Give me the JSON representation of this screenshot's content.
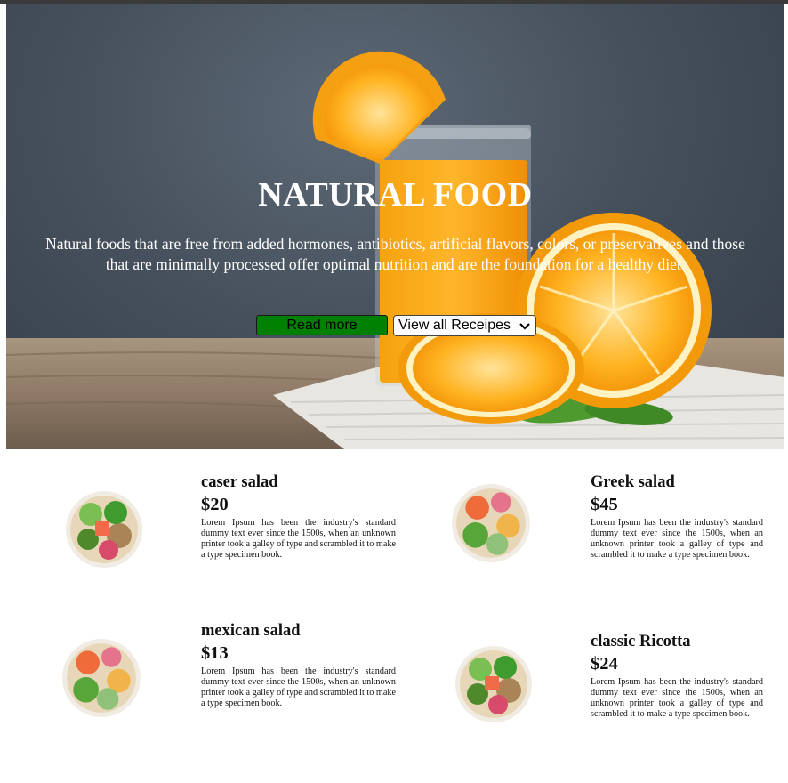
{
  "hero": {
    "title": "NATURAL FOOD",
    "description": "Natural foods that are free from added hormones, antibiotics, artificial flavors, colors, or preservatives and those that are minimally processed offer optimal nutrition and are the foundation for a healthy diet.",
    "read_more_label": "Read more",
    "recipes_select_value": "View all Receipes",
    "read_more_color": "#008000"
  },
  "menu": {
    "items": [
      {
        "name": "caser salad",
        "price": "$20",
        "description": "Lorem Ipsum has been the industry's standard dummy text ever since the 1500s, when an unknown printer took a galley of type and scrambled it to make a type specimen book."
      },
      {
        "name": "Greek salad",
        "price": "$45",
        "description": "Lorem Ipsum has been the industry's standard dummy text ever since the 1500s, when an unknown printer took a galley of type and scrambled it to make a type specimen book."
      },
      {
        "name": "mexican salad",
        "price": "$13",
        "description": "Lorem Ipsum has been the industry's standard dummy text ever since the 1500s, when an unknown printer took a galley of type and scrambled it to make a type specimen book."
      },
      {
        "name": "classic Ricotta",
        "price": "$24",
        "description": "Lorem Ipsum has been the industry's standard dummy text ever since the 1500s, when an unknown printer took a galley of type and scrambled it to make a type specimen book."
      }
    ]
  }
}
